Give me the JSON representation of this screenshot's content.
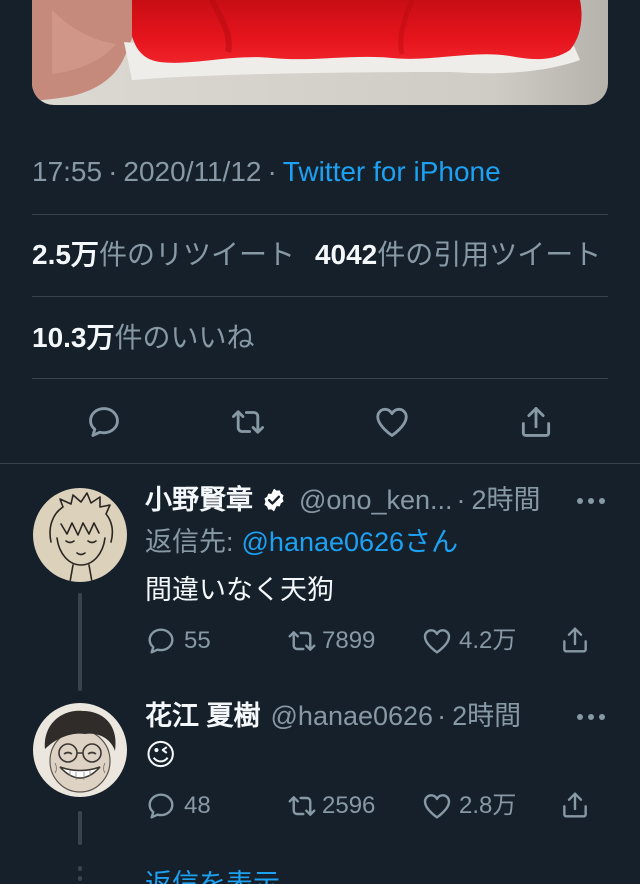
{
  "colors": {
    "background": "#15202b",
    "text_primary": "#f5f8fa",
    "text_secondary": "#8899a6",
    "accent": "#1da1f2",
    "divider": "#38444d"
  },
  "tweet": {
    "time": "17:55",
    "separator": "·",
    "date": "2020/11/12",
    "source": "Twitter for iPhone",
    "stats": {
      "retweets": {
        "count": "2.5万",
        "label": "件のリツイート"
      },
      "quote_tweets": {
        "count": "4042",
        "label": "件の引用ツイート"
      },
      "likes": {
        "count": "10.3万",
        "label": "件のいいね"
      }
    },
    "action_icons": [
      "reply-icon",
      "retweet-icon",
      "like-icon",
      "share-icon"
    ]
  },
  "replies": [
    {
      "name": "小野賢章",
      "verified": true,
      "handle": "@ono_ken...",
      "separator": "·",
      "time": "2時間",
      "reply_to_label": "返信先:",
      "reply_to_handle": "@hanae0626さん",
      "text": "間違いなく天狗",
      "counts": {
        "replies": "55",
        "retweets": "7899",
        "likes": "4.2万"
      }
    },
    {
      "name": "花江 夏樹",
      "verified": false,
      "handle": "@hanae0626",
      "separator": "·",
      "time": "2時間",
      "text": "😉",
      "counts": {
        "replies": "48",
        "retweets": "2596",
        "likes": "2.8万"
      }
    }
  ],
  "show_replies_label": "返信を表示",
  "icons": [
    "reply-icon",
    "retweet-icon",
    "like-icon",
    "share-icon",
    "more-icon",
    "verified-badge-icon"
  ]
}
